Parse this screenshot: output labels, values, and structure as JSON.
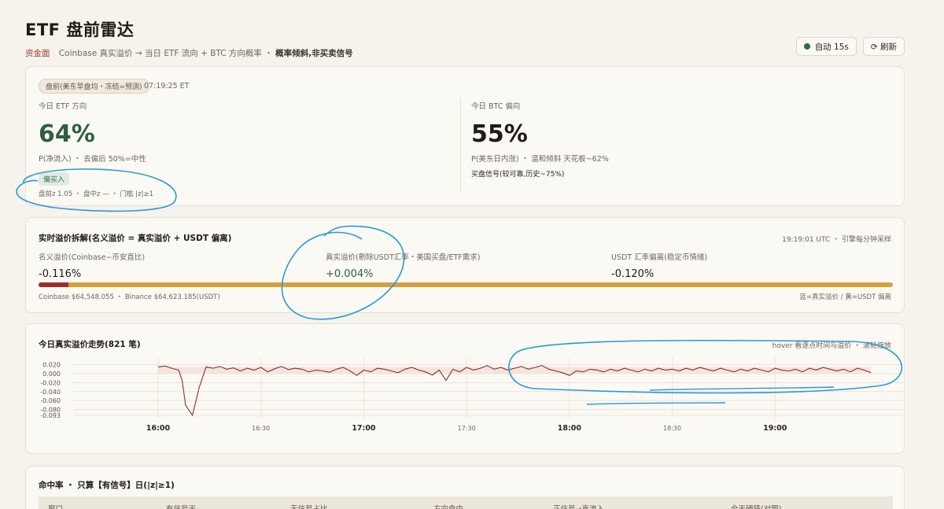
{
  "header": {
    "title": "ETF 盘前雷达",
    "tag": "资金面",
    "desc": "Coinbase 真实溢价 → 当日 ETF 流向 + BTC 方向概率 ・",
    "emph": "概率倾斜,非买卖信号",
    "auto_label": "自动 15s",
    "refresh_label": "⟳ 刷新"
  },
  "prob": {
    "pill": "盘前(美东早盘均・冻结=预测)",
    "time": "07:19:25 ET",
    "etf": {
      "label": "今日 ETF 方向",
      "value": "64%",
      "desc": "P(净流入) ・ 去偏后 50%=中性",
      "badge": "偏买入",
      "detail": "盘前z 1.05 ・ 盘中z — ・ 门槛 |z|≥1"
    },
    "btc": {
      "label": "今日 BTC 偏向",
      "value": "55%",
      "desc": "P(美东日内涨) ・ 温和倾斜 天花板~62%",
      "note": "买盘信号(较可靠,历史~75%)"
    }
  },
  "decomp": {
    "title": "实时溢价拆解(名义溢价 = 真实溢价 + USDT 偏离)",
    "meta": "19:19:01 UTC ・ 引擎每分钟采样",
    "cols": [
      {
        "label": "名义溢价(Coinbase−币安直比)",
        "value": "-0.116%"
      },
      {
        "label": "真实溢价(剔除USDT汇率・美国买盘/ETF需求)",
        "value": "+0.004%"
      },
      {
        "label": "USDT 汇率偏离(稳定币情绪)",
        "value": "-0.120%"
      }
    ],
    "bar_real_fraction": 0.035,
    "footer_left": "Coinbase $64,548.055 ・ Binance $64,623.185(USDT)",
    "footer_right": "蓝=真实溢价 / 黄=USDT 偏离"
  },
  "trend": {
    "title": "今日真实溢价走势(821 笔)",
    "hint": "hover 看逐点时间与溢价 ・ 滚轮缩放"
  },
  "chart_data": {
    "type": "line",
    "title": "今日真实溢价走势(821 笔)",
    "xlabel": "",
    "ylabel": "",
    "x_ticks": [
      "16:00",
      "16:30",
      "17:00",
      "17:30",
      "18:00",
      "18:30",
      "19:00"
    ],
    "y_ticks": [
      "0.020",
      "0.000",
      "-0.020",
      "-0.040",
      "-0.060",
      "-0.080",
      "-0.093"
    ],
    "ylim": [
      -0.093,
      0.028
    ],
    "x_range": [
      "16:00",
      "19:30"
    ],
    "series": [
      {
        "color": "#8b2e2e",
        "x_minutes": [
          0,
          2,
          4,
          6,
          7,
          8,
          10,
          12,
          14,
          16,
          18,
          20,
          22,
          24,
          26,
          28,
          30,
          32,
          34,
          36,
          38,
          40,
          42,
          44,
          46,
          48,
          50,
          52,
          54,
          56,
          58,
          60,
          62,
          64,
          66,
          68,
          70,
          72,
          74,
          76,
          78,
          80,
          82,
          84,
          86,
          88,
          90,
          92,
          94,
          96,
          98,
          100,
          102,
          104,
          106,
          108,
          110,
          112,
          114,
          116,
          118,
          120,
          122,
          124,
          126,
          128,
          130,
          132,
          134,
          136,
          138,
          140,
          142,
          144,
          146,
          148,
          150,
          152,
          154,
          156,
          158,
          160,
          162,
          164,
          166,
          168,
          170,
          172,
          174,
          176,
          178,
          180,
          182,
          184,
          186,
          188,
          190,
          192,
          194,
          196,
          198,
          200,
          202,
          204,
          206,
          208
        ],
        "values": [
          0.015,
          0.017,
          0.012,
          0.008,
          -0.015,
          -0.07,
          -0.093,
          -0.03,
          0.015,
          0.012,
          0.016,
          0.01,
          0.013,
          0.006,
          0.012,
          0.008,
          0.014,
          0.004,
          0.011,
          0.016,
          0.009,
          0.012,
          0.01,
          0.004,
          0.008,
          0.006,
          0.003,
          0.01,
          0.014,
          0.006,
          -0.004,
          0.008,
          0.004,
          0.012,
          0.01,
          0.006,
          0.002,
          0.01,
          0.014,
          0.008,
          0.004,
          -0.003,
          0.008,
          -0.015,
          0.01,
          0.004,
          0.014,
          0.008,
          0.012,
          0.018,
          0.01,
          0.014,
          0.008,
          0.012,
          0.016,
          0.01,
          0.014,
          0.018,
          0.01,
          0.006,
          0.002,
          -0.004,
          0.006,
          0.004,
          0.01,
          0.008,
          0.004,
          0.01,
          0.006,
          0.012,
          0.008,
          0.004,
          0.01,
          0.006,
          0.012,
          0.008,
          0.01,
          0.006,
          0.012,
          0.008,
          0.014,
          0.01,
          0.006,
          0.012,
          0.008,
          0.004,
          0.01,
          0.006,
          0.012,
          0.008,
          0.004,
          0.012,
          0.008,
          0.006,
          0.01,
          0.004,
          0.012,
          0.008,
          0.014,
          0.01,
          0.006,
          0.01,
          0.004,
          0.012,
          0.008,
          0.002
        ]
      }
    ]
  },
  "hit": {
    "title": "命中率 ・ 只算【有信号】日(|z|≥1)",
    "headers": [
      "窗口",
      "有信号天",
      "无信号占比",
      "方向命中",
      "正信号→真流入",
      "全天硬猜(对照)"
    ]
  }
}
